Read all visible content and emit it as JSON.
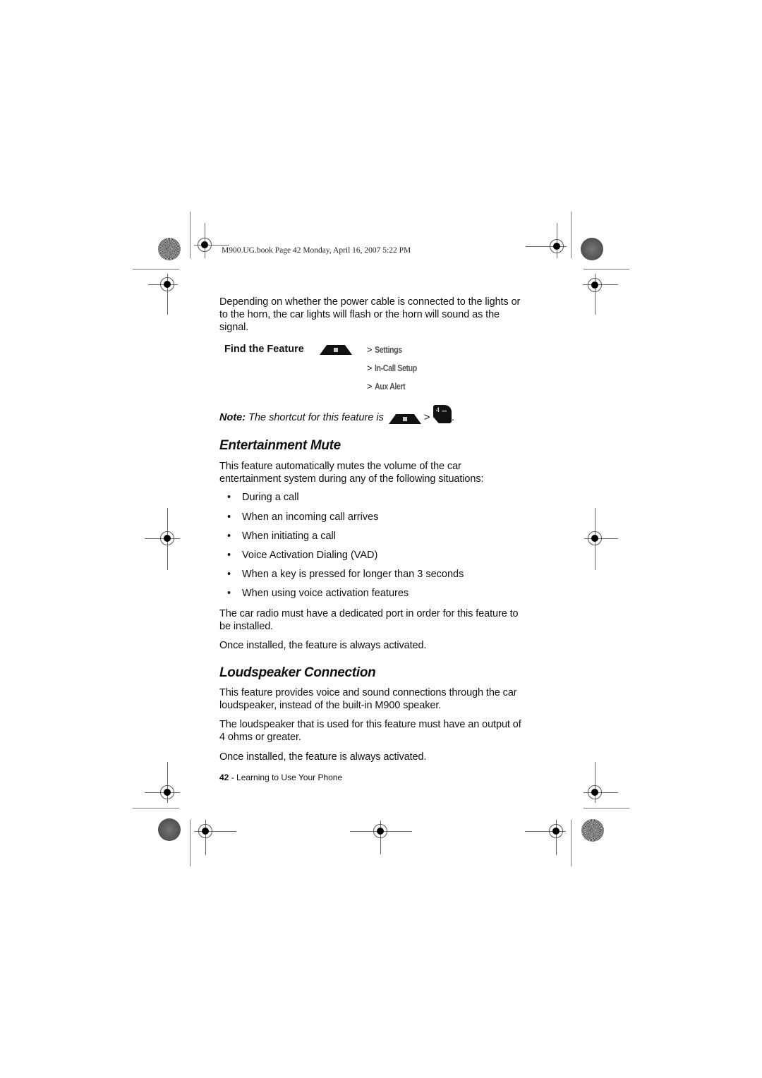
{
  "header_stamp": "M900.UG.book  Page 42  Monday, April 16, 2007  5:22 PM",
  "intro_paragraph": [
    "Depending on whether the power cable is connected to the lights or",
    "to the horn, the car lights will flash or the horn will sound as the",
    "signal."
  ],
  "find_the_feature": {
    "label": "Find the Feature",
    "menu_key_icon": "menu-key-icon",
    "path": [
      {
        "sep": ">",
        "item": "Settings"
      },
      {
        "sep": ">",
        "item": "In-Call Setup"
      },
      {
        "sep": ">",
        "item": "Aux Alert"
      }
    ]
  },
  "note": {
    "label": "Note:",
    "text": " The shortcut for this feature is ",
    "separator": ">",
    "end": ".",
    "key_number": "4",
    "key_letters": "GHI"
  },
  "sections": [
    {
      "title": "Entertainment Mute",
      "intro": [
        "This feature automatically mutes the volume of the car",
        "entertainment system during any of the following situations:"
      ],
      "bullets": [
        "During a call",
        "When an incoming call arrives",
        "When initiating a call",
        "Voice Activation Dialing (VAD)",
        "When a key is pressed for longer than 3 seconds",
        "When using voice activation features"
      ],
      "paragraphs": [
        [
          "The car radio must have a dedicated port in order for this feature to",
          "be installed."
        ],
        [
          "Once installed, the feature is always activated."
        ]
      ]
    },
    {
      "title": "Loudspeaker Connection",
      "paragraphs": [
        [
          "This feature provides voice and sound connections through the car",
          "loudspeaker, instead of the built-in M900 speaker."
        ],
        [
          "The loudspeaker that is used for this feature must have an output of",
          "4 ohms or greater."
        ],
        [
          "Once installed, the feature is always activated."
        ]
      ]
    }
  ],
  "footer": {
    "page_number": "42",
    "separator": " - ",
    "chapter": "Learning to Use Your Phone"
  }
}
